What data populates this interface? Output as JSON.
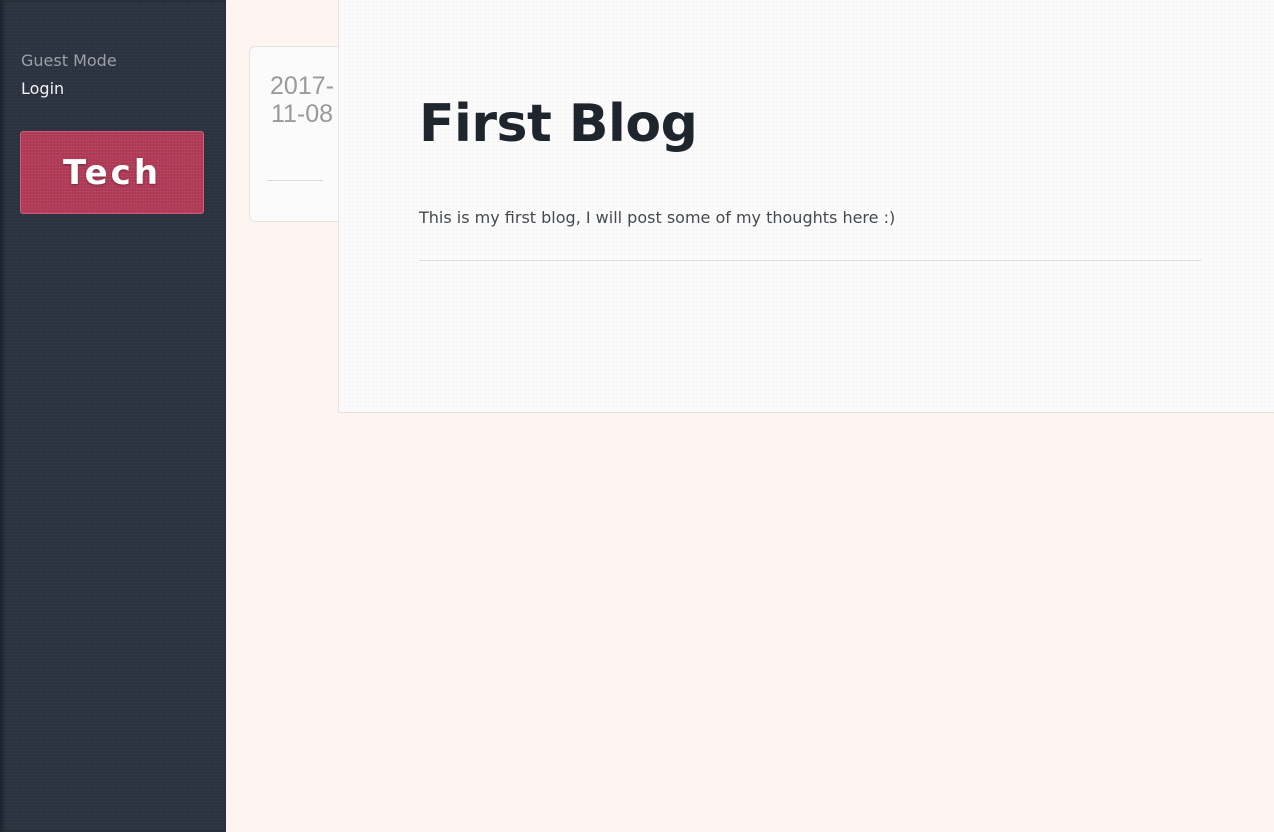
{
  "sidebar": {
    "guest_mode": "Guest Mode",
    "login_label": "Login",
    "category_button": "Tech"
  },
  "post": {
    "date": "2017-11-08",
    "title": "First Blog",
    "body": "This is my first blog, I will post some of my thoughts here :)"
  },
  "colors": {
    "sidebar_bg": "#2c3442",
    "category_button_bg": "#b23b58",
    "page_bg": "#fff5f0",
    "card_bg": "#fbfbfb"
  }
}
